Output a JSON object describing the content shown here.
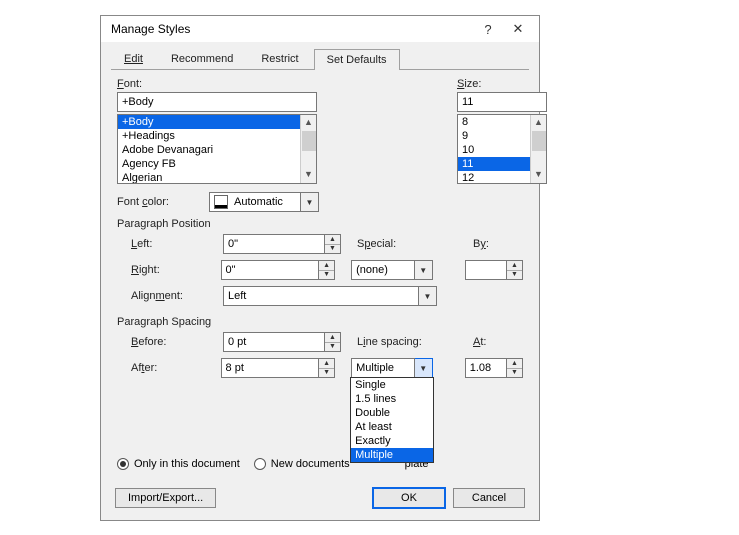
{
  "title": "Manage Styles",
  "help_glyph": "?",
  "close_glyph": "✕",
  "tabs": {
    "edit": "Edit",
    "recommend": "Recommend",
    "restrict": "Restrict",
    "setdefaults": "Set Defaults"
  },
  "font": {
    "label": "Font:",
    "label_u": "F",
    "value": "+Body",
    "options": [
      "+Body",
      "+Headings",
      "Adobe Devanagari",
      "Agency FB",
      "Algerian"
    ],
    "color_label": "Font color:",
    "color_label_u": "c",
    "color_value": "Automatic"
  },
  "size": {
    "label": "Size:",
    "label_u": "S",
    "value": "11",
    "options": [
      "8",
      "9",
      "10",
      "11",
      "12"
    ]
  },
  "para_pos": {
    "heading": "Paragraph Position",
    "left_label": "Left:",
    "left_u": "L",
    "left_value": "0\"",
    "right_label": "Right:",
    "right_u": "R",
    "right_value": "0\"",
    "special_label": "Special:",
    "special_u": "p",
    "special_value": "(none)",
    "by_label": "By:",
    "by_u": "y",
    "by_value": "",
    "align_label": "Alignment:",
    "align_u": "m",
    "align_value": "Left"
  },
  "para_spc": {
    "heading": "Paragraph Spacing",
    "before_label": "Before:",
    "before_u": "B",
    "before_value": "0 pt",
    "after_label": "After:",
    "after_value": "8 pt",
    "ls_label": "Line spacing:",
    "ls_u": "i",
    "ls_value": "Multiple",
    "ls_options": [
      "Single",
      "1.5 lines",
      "Double",
      "At least",
      "Exactly",
      "Multiple"
    ],
    "at_label": "At:",
    "at_u": "A",
    "at_value": "1.08"
  },
  "scope": {
    "only": "Only in this document",
    "newdocs_pre": "New documents",
    "newdocs_suffix": "plate"
  },
  "buttons": {
    "import": "Import/Export...",
    "ok": "OK",
    "cancel": "Cancel"
  }
}
